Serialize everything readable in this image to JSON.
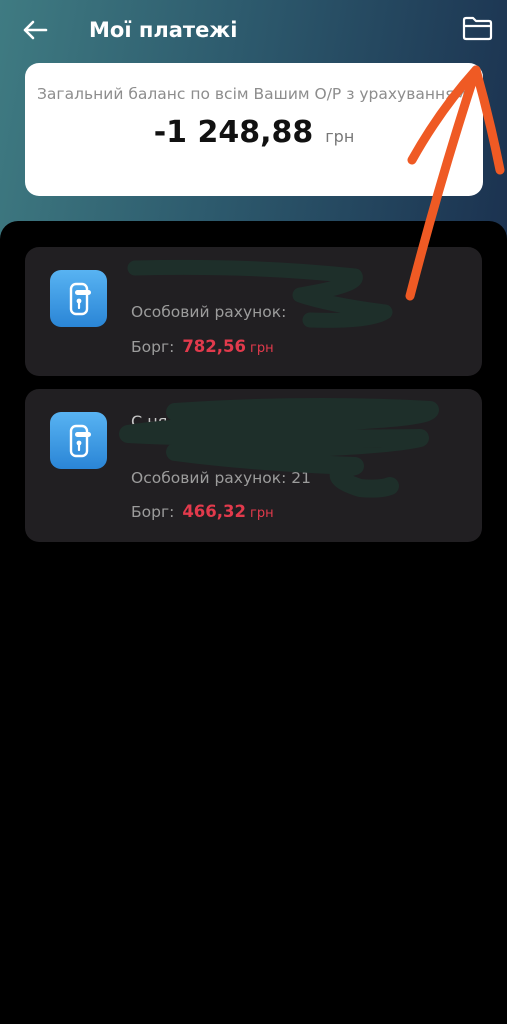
{
  "header": {
    "title": "Мої платежі",
    "back_icon": "arrow-left-icon",
    "folder_icon": "folder-icon"
  },
  "balance": {
    "description": "Загальний баланс по всім Вашим О/Р з урахуванням боргу та переплати становить",
    "amount": "-1 248,88",
    "currency": "грн"
  },
  "accounts": [
    {
      "name": "",
      "account_label": "Особовий рахунок:",
      "account_number": "",
      "debt_label": "Борг:",
      "debt_value": "782,56",
      "debt_currency": "грн",
      "icon": "door-handle-icon"
    },
    {
      "name": "С                                                    ня б",
      "account_label": "Особовий рахунок:",
      "account_number": "21",
      "debt_label": "Борг:",
      "debt_value": "466,32",
      "debt_currency": "грн",
      "icon": "door-handle-icon"
    }
  ],
  "colors": {
    "header_gradient_start": "#3f7b82",
    "header_gradient_end": "#1b3250",
    "card_bg": "#211f22",
    "debt": "#e23a4c",
    "icon_blue": "#3b9be6",
    "annotation_arrow": "#ef5a24",
    "redaction": "#1e2f2a"
  }
}
